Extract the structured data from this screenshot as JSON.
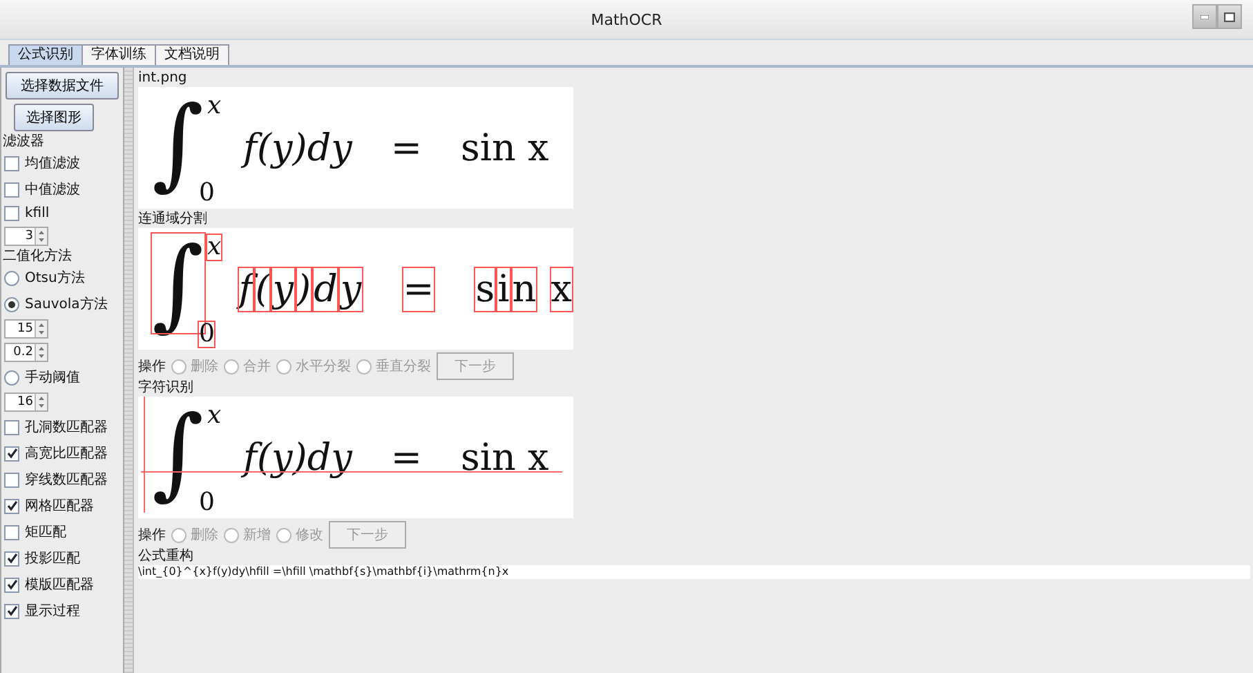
{
  "window": {
    "title": "MathOCR"
  },
  "tabs": [
    {
      "label": "公式识别",
      "selected": true
    },
    {
      "label": "字体训练",
      "selected": false
    },
    {
      "label": "文档说明",
      "selected": false
    }
  ],
  "sidebar": {
    "items": [
      {
        "kind": "button",
        "label": "选择数据文件"
      },
      {
        "kind": "button",
        "label": "选择图形"
      },
      {
        "kind": "heading",
        "label": "滤波器"
      },
      {
        "kind": "checkbox",
        "label": "均值滤波",
        "checked": false
      },
      {
        "kind": "checkbox",
        "label": "中值滤波",
        "checked": false
      },
      {
        "kind": "checkbox",
        "label": "kfill",
        "checked": false
      },
      {
        "kind": "spinner",
        "value": "3"
      },
      {
        "kind": "heading",
        "label": "二值化方法"
      },
      {
        "kind": "radio",
        "label": "Otsu方法",
        "selected": false
      },
      {
        "kind": "radio",
        "label": "Sauvola方法",
        "selected": true
      },
      {
        "kind": "spinner",
        "value": "15"
      },
      {
        "kind": "spinner",
        "value": "0.2"
      },
      {
        "kind": "radio",
        "label": "手动阈值",
        "selected": false
      },
      {
        "kind": "spinner",
        "value": "16"
      },
      {
        "kind": "checkbox",
        "label": "孔洞数匹配器",
        "checked": false
      },
      {
        "kind": "checkbox",
        "label": "高宽比匹配器",
        "checked": true
      },
      {
        "kind": "checkbox",
        "label": "穿线数匹配器",
        "checked": false
      },
      {
        "kind": "checkbox",
        "label": "网格匹配器",
        "checked": true
      },
      {
        "kind": "checkbox",
        "label": "矩匹配",
        "checked": false
      },
      {
        "kind": "checkbox",
        "label": "投影匹配",
        "checked": true
      },
      {
        "kind": "checkbox",
        "label": "模版匹配器",
        "checked": true
      },
      {
        "kind": "checkbox",
        "label": "显示过程",
        "checked": true
      }
    ]
  },
  "sections": [
    {
      "kind": "image",
      "label": "int.png",
      "formula": {
        "integral": "∫",
        "upper": "x",
        "lower": "0",
        "integrand": "f(y)dy",
        "equals": "=",
        "rhs": "sin x"
      }
    },
    {
      "kind": "segmentation",
      "label": "连通域分割",
      "formula": {
        "integral": "∫",
        "upper": "x",
        "lower": "0",
        "integrand": "f(y)dy",
        "equals": "=",
        "rhs": "sin x"
      },
      "operations": {
        "label": "操作",
        "options": [
          {
            "label": "删除",
            "selected": false
          },
          {
            "label": "合并",
            "selected": false
          },
          {
            "label": "水平分裂",
            "selected": false
          },
          {
            "label": "垂直分裂",
            "selected": false
          }
        ],
        "button": "下一步",
        "disabled": true
      }
    },
    {
      "kind": "recognition",
      "label": "字符识别",
      "formula": {
        "integral": "∫",
        "upper": "x",
        "lower": "0",
        "integrand": "f(y)dy",
        "equals": "=",
        "rhs": "sin x"
      },
      "operations": {
        "label": "操作",
        "options": [
          {
            "label": "删除",
            "selected": false
          },
          {
            "label": "新增",
            "selected": false
          },
          {
            "label": "修改",
            "selected": false
          }
        ],
        "button": "下一步",
        "disabled": true
      }
    }
  ],
  "reconstruction": {
    "label": "公式重构",
    "text": "\\int_{0}^{x}f(y)dy\\hfill =\\hfill  \\mathbf{s}\\mathbf{i}\\mathrm{n}x"
  }
}
